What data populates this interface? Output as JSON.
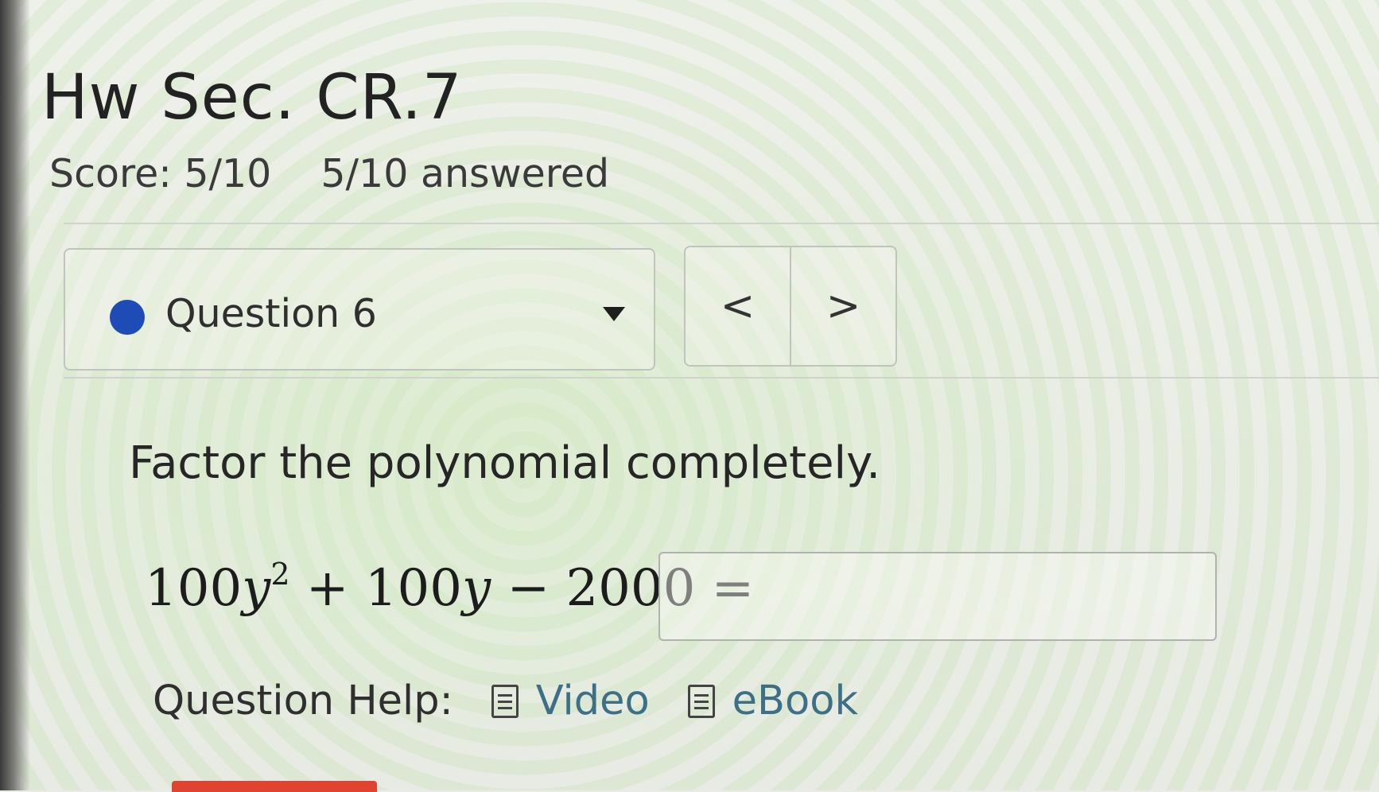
{
  "header": {
    "title": "Hw Sec. CR.7",
    "score": "Score: 5/10",
    "answered": "5/10 answered"
  },
  "question_nav": {
    "selected": "Question 6",
    "status_color": "#1f4bb7",
    "prev_label": "<",
    "next_label": ">"
  },
  "question": {
    "prompt": "Factor the polynomial completely.",
    "equation": {
      "term1_coef": "100",
      "term1_var": "y",
      "term1_exp": "2",
      "op1": " + ",
      "term2_coef": "100",
      "term2_var": "y",
      "op2": " − ",
      "constant": "2000",
      "equals": " ="
    },
    "answer_value": ""
  },
  "help": {
    "label": "Question Help:",
    "links": [
      {
        "label": "Video",
        "icon": "document-icon"
      },
      {
        "label": "eBook",
        "icon": "document-icon"
      }
    ]
  },
  "colors": {
    "link": "#3d6f86",
    "submit_accent": "#e0432f"
  }
}
